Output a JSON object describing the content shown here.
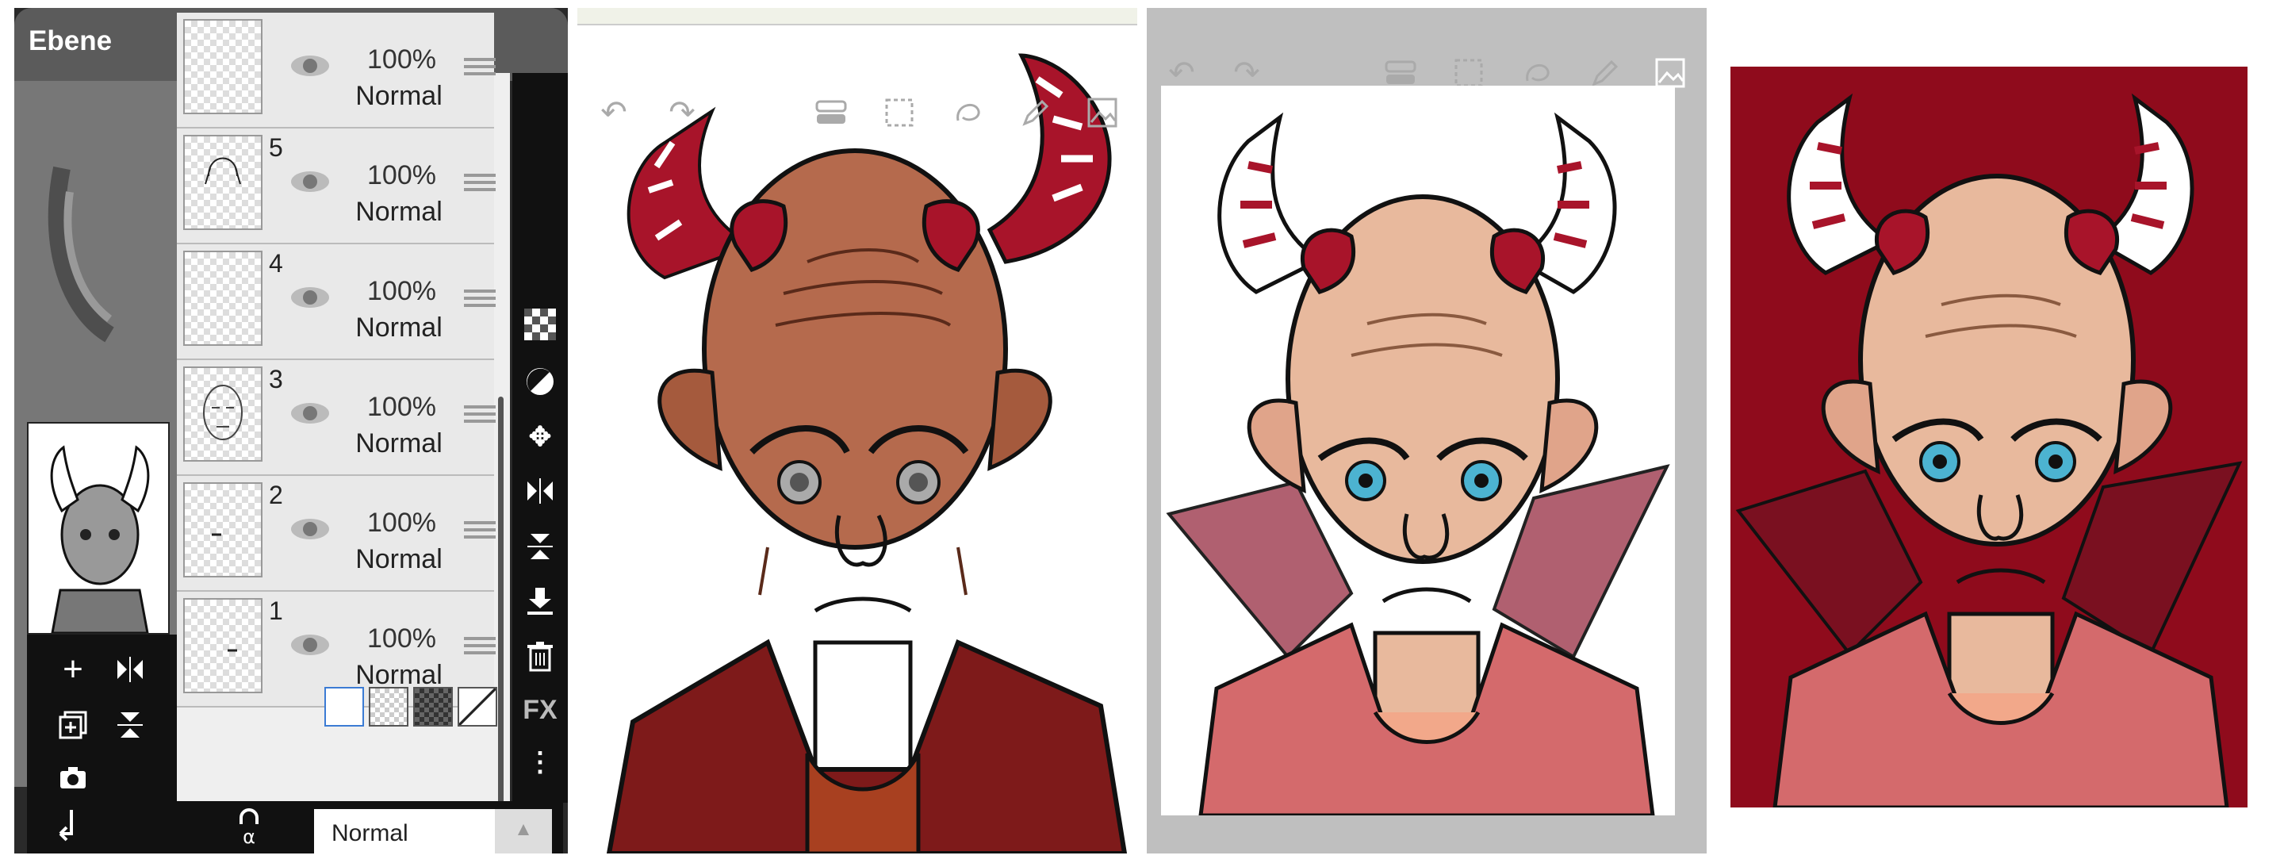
{
  "app": {
    "panel_title": "Ebene"
  },
  "layers": [
    {
      "number": "",
      "opacity": "100%",
      "blend": "Normal"
    },
    {
      "number": "5",
      "opacity": "100%",
      "blend": "Normal"
    },
    {
      "number": "4",
      "opacity": "100%",
      "blend": "Normal"
    },
    {
      "number": "3",
      "opacity": "100%",
      "blend": "Normal"
    },
    {
      "number": "2",
      "opacity": "100%",
      "blend": "Normal"
    },
    {
      "number": "1",
      "opacity": "100%",
      "blend": "Normal"
    }
  ],
  "side_tools": [
    "checker-icon",
    "halftone-icon",
    "move-icon",
    "flip-horizontal-icon",
    "flip-vertical-icon",
    "merge-down-icon",
    "trash-icon",
    "FX",
    "more-icon"
  ],
  "side_fx_label": "FX",
  "bottom_bar": {
    "blend_mode": "Normal",
    "lock_glyph": "α"
  },
  "colors": {
    "skin_red": "#b56a4d",
    "skin_light": "#e8b99d",
    "horn": "#a8142a",
    "jacket_dark": "#7e1a1a",
    "jacket_pink": "#d46a6c",
    "bg_red": "#8f0b1c",
    "eye_blue": "#4cb3d1"
  }
}
